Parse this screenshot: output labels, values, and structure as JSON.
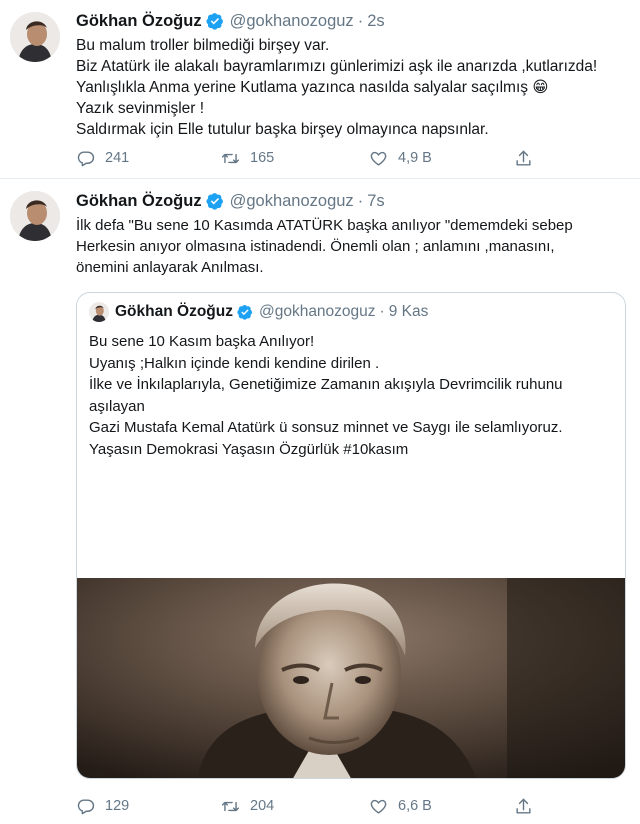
{
  "tweets": [
    {
      "author": {
        "name": "Gökhan Özoğuz",
        "handle": "@gokhanozoguz"
      },
      "separator": "·",
      "time": "2s",
      "text": "Bu malum troller bilmediği birşey var.\nBiz Atatürk ile alakalı bayramlarımızı günlerimizi aşk ile anarızda ,kutlarızda!\nYanlışlıkla Anma yerine Kutlama yazınca nasılda salyalar saçılmış 😁\nYazık sevinmişler !\nSaldırmak için Elle tutulur başka birşey olmayınca napsınlar.",
      "stats": {
        "replies": "241",
        "retweets": "165",
        "likes": "4,9 B"
      }
    },
    {
      "author": {
        "name": "Gökhan Özoğuz",
        "handle": "@gokhanozoguz"
      },
      "separator": "·",
      "time": "7s",
      "text": "İlk defa \"Bu sene 10 Kasımda ATATÜRK başka anılıyor \"dememdeki sebep\nHerkesin anıyor olmasına istinadendi. Önemli olan ; anlamını ,manasını,\nönemini anlayarak Anılması.",
      "quoted": {
        "author": {
          "name": "Gökhan Özoğuz",
          "handle": "@gokhanozoguz"
        },
        "separator": "·",
        "time": "9 Kas",
        "text": "Bu sene 10 Kasım başka Anılıyor!\nUyanış ;Halkın içinde kendi kendine dirilen .\nİlke ve İnkılaplarıyla, Genetiğimize Zamanın akışıyla Devrimcilik ruhunu\naşılayan\nGazi Mustafa Kemal Atatürk ü sonsuz minnet ve Saygı ile selamlıyoruz.\nYaşasın Demokrasi Yaşasın Özgürlük #10kasım",
        "photo": "portrait-photo"
      },
      "stats": {
        "replies": "129",
        "retweets": "204",
        "likes": "6,6 B"
      }
    }
  ],
  "icons": {
    "verified": "verified-badge-icon",
    "reply": "reply-icon",
    "retweet": "retweet-icon",
    "like": "heart-icon",
    "share": "share-icon"
  },
  "colors": {
    "text": "#14171a",
    "secondary": "#657786",
    "verified": "#1da1f2",
    "border": "#e6ecf0",
    "quote_border": "#ccd6dd"
  }
}
